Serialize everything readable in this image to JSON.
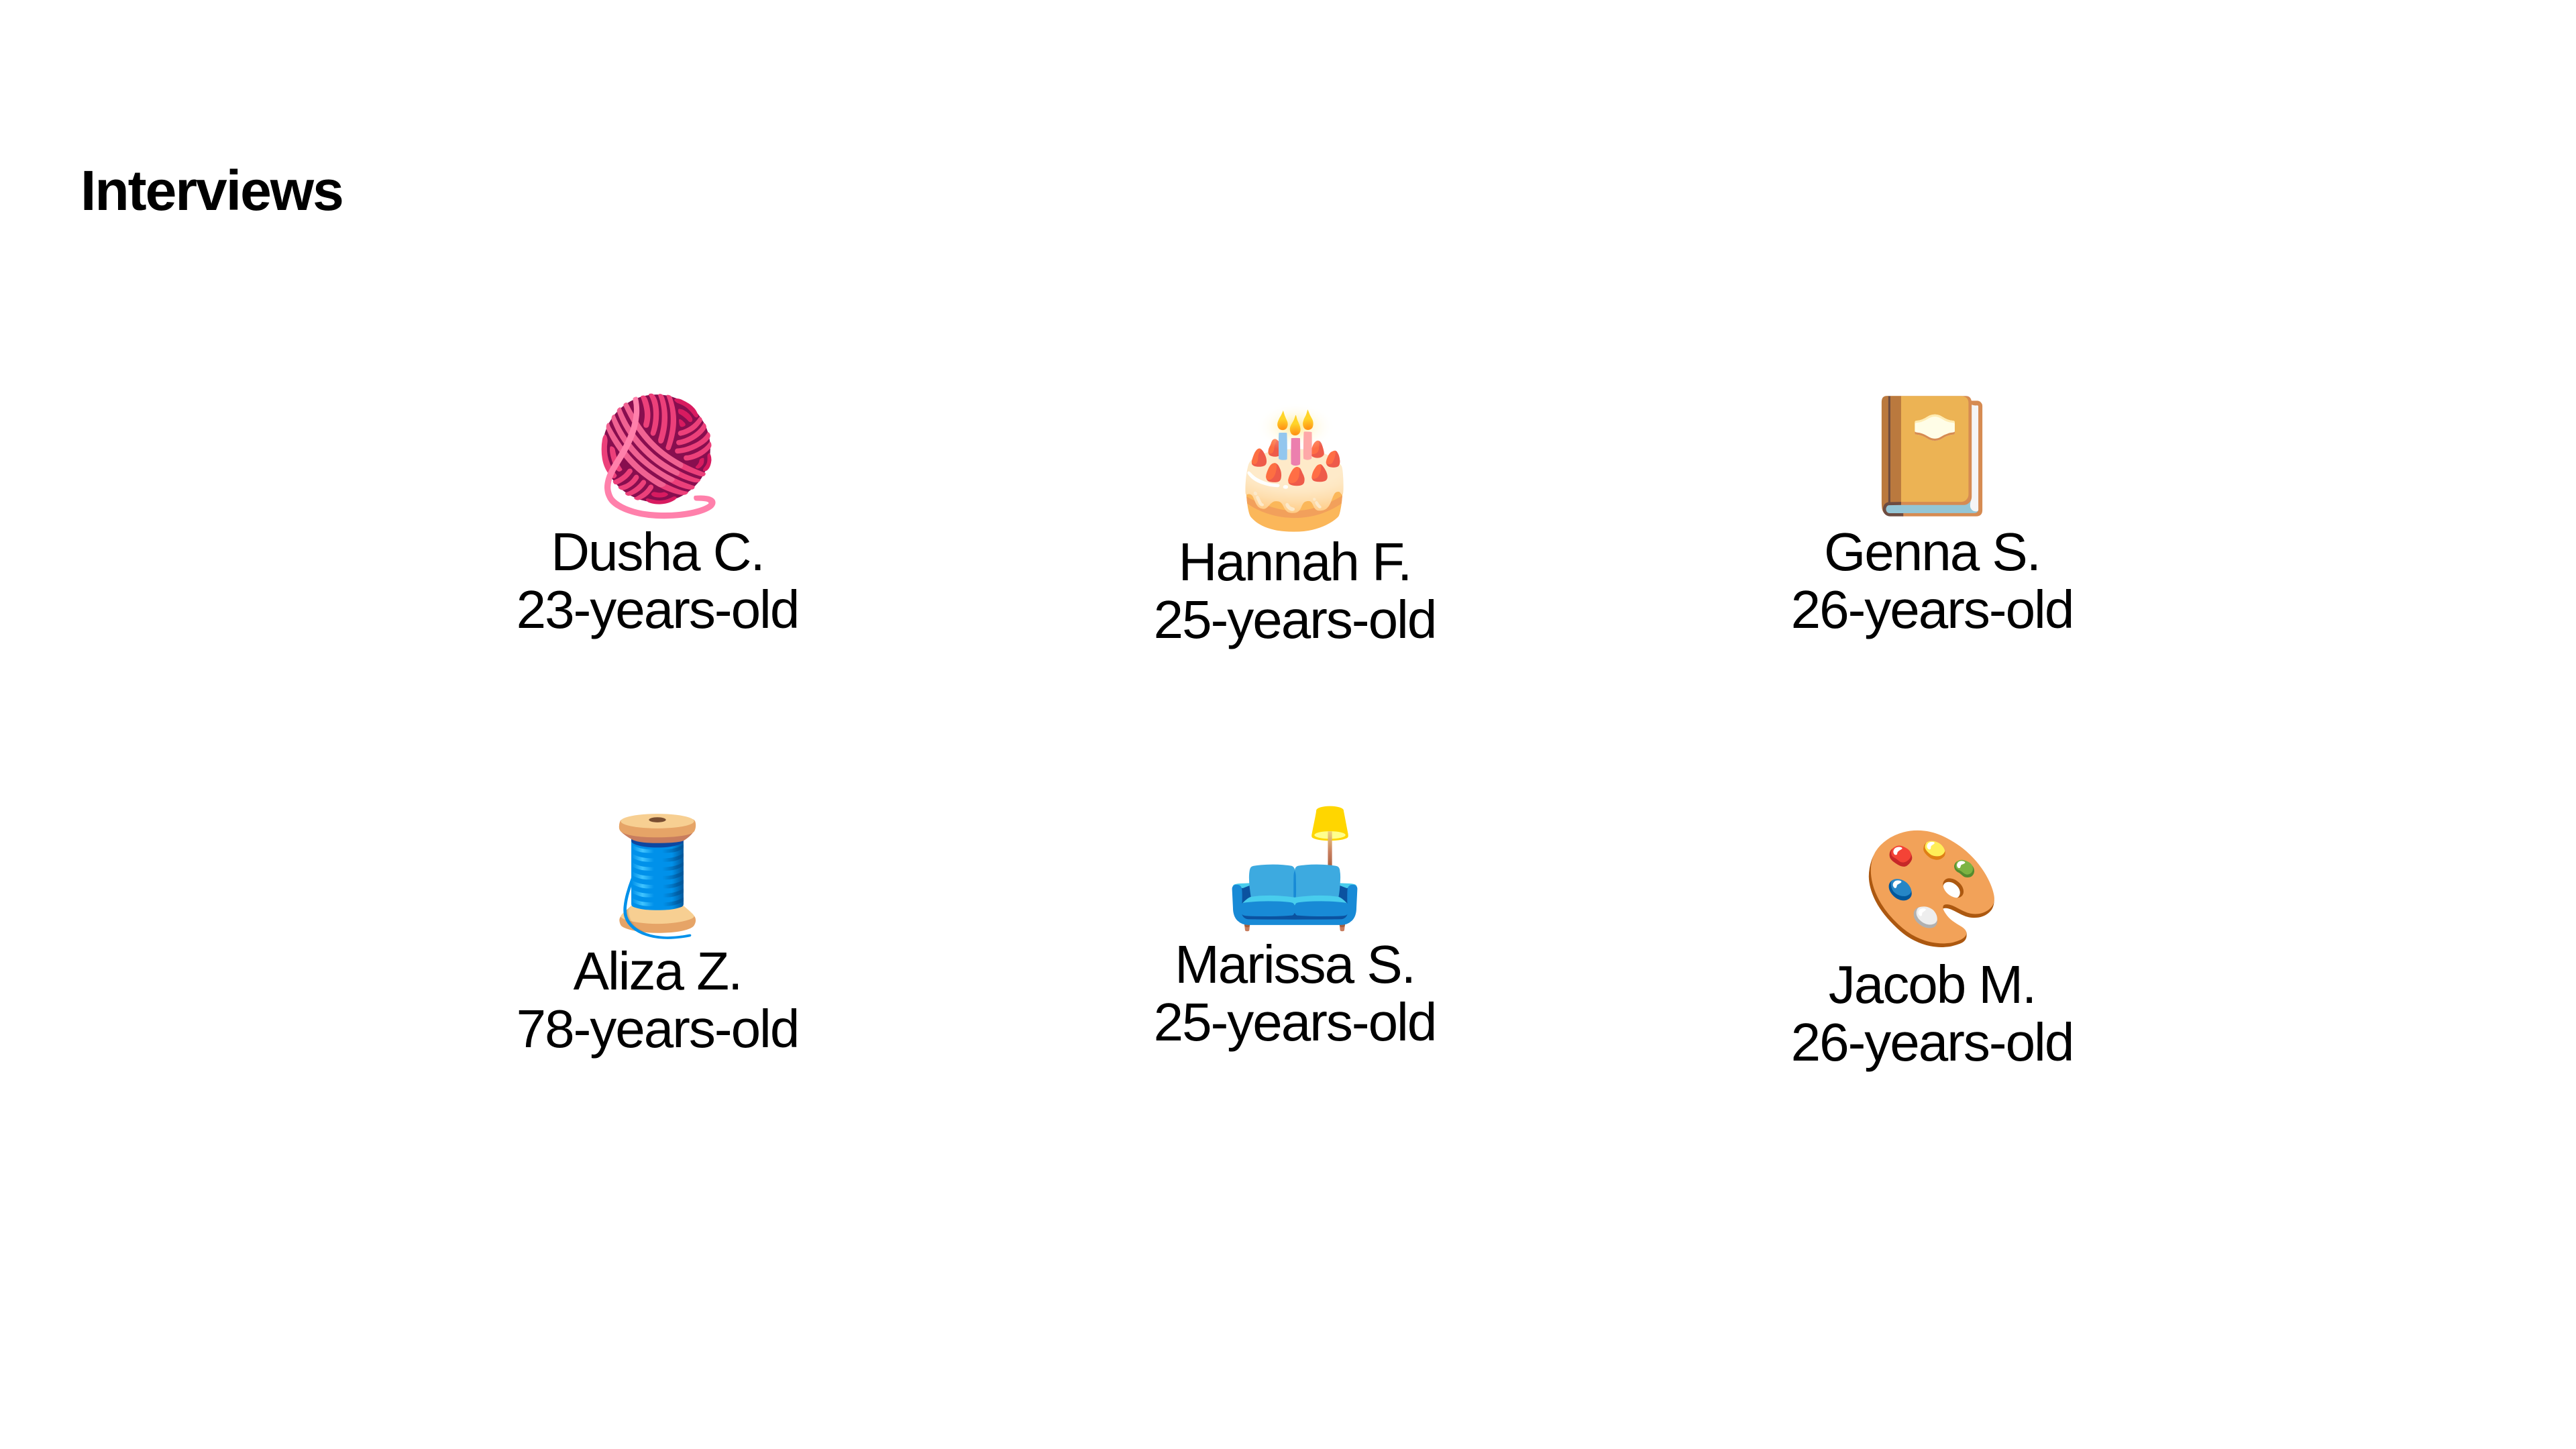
{
  "slide": {
    "title": "Interviews"
  },
  "interviews": [
    {
      "icon": "yarn-icon",
      "emoji": "🧶",
      "name": "Dusha C.",
      "age": "23-years-old"
    },
    {
      "icon": "birthday-cake-icon",
      "emoji": "🎂",
      "name": "Hannah F.",
      "age": "25-years-old"
    },
    {
      "icon": "notebook-icon",
      "emoji": "📔",
      "name": "Genna S.",
      "age": "26-years-old"
    },
    {
      "icon": "thread-spool-icon",
      "emoji": "🧵",
      "name": "Aliza Z.",
      "age": "78-years-old"
    },
    {
      "icon": "couch-and-lamp-icon",
      "emoji": "🛋️",
      "name": "Marissa S.",
      "age": "25-years-old"
    },
    {
      "icon": "artist-palette-icon",
      "emoji": "🎨",
      "name": "Jacob M.",
      "age": "26-years-old"
    }
  ]
}
